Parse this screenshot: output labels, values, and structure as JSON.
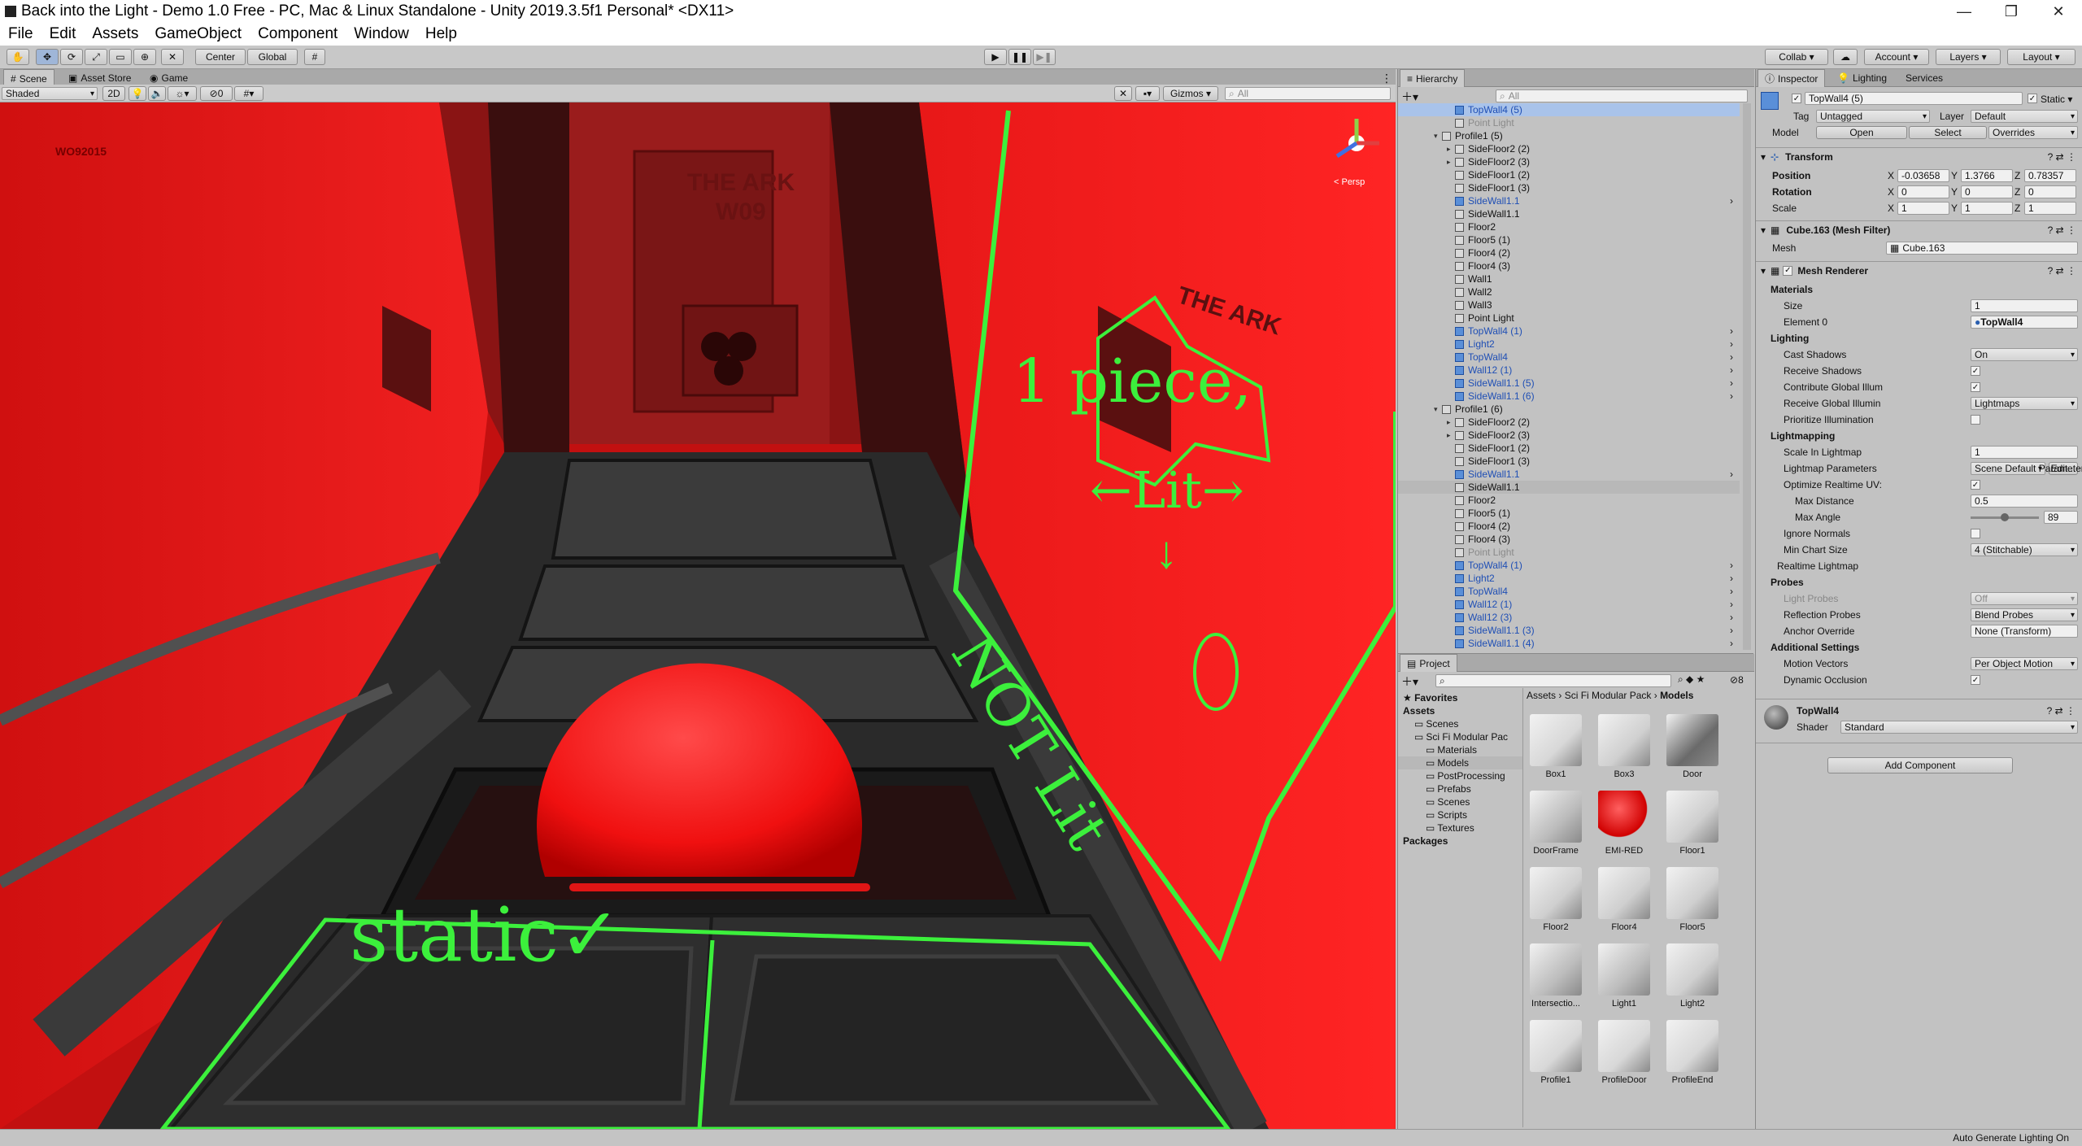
{
  "window": {
    "title": "Back into the Light - Demo 1.0 Free - PC, Mac & Linux Standalone - Unity 2019.3.5f1 Personal* <DX11>",
    "min": "—",
    "max": "❐",
    "close": "✕"
  },
  "menu": [
    "File",
    "Edit",
    "Assets",
    "GameObject",
    "Component",
    "Window",
    "Help"
  ],
  "toolbar": {
    "center": "Center",
    "global": "Global",
    "collab": "Collab ▾",
    "account": "Account ▾",
    "layers": "Layers ▾",
    "layout": "Layout ▾"
  },
  "scene_panel": {
    "tabs": [
      "Scene",
      "Asset Store",
      "Game"
    ],
    "shaded": "Shaded",
    "mode_2d": "2D",
    "gizmos": "Gizmos ▾",
    "search_placeholder": "All",
    "persp": "< Persp",
    "counter": "0"
  },
  "scene_text": {
    "label_left": "WO92015",
    "ark_title": "THE ARK",
    "ark_sub": "W09",
    "wall_logo": "THE ARK"
  },
  "annotations": {
    "static": "static✓",
    "piece": "1 piece,",
    "lit": "←Lit→",
    "not_lit": "NOT Lit",
    "arrow": "↓"
  },
  "hierarchy": {
    "title": "Hierarchy",
    "search_placeholder": "All",
    "items": [
      {
        "name": "TopWall4 (5)",
        "blue": true,
        "indent": 0,
        "sel": true
      },
      {
        "name": "Point Light",
        "grey": true,
        "indent": 0
      },
      {
        "name": "Profile1 (5)",
        "indent": -1,
        "open": true
      },
      {
        "name": "SideFloor2 (2)",
        "indent": 0,
        "arrow": true
      },
      {
        "name": "SideFloor2 (3)",
        "indent": 0,
        "arrow": true
      },
      {
        "name": "SideFloor1 (2)",
        "indent": 0
      },
      {
        "name": "SideFloor1 (3)",
        "indent": 0
      },
      {
        "name": "SideWall1.1",
        "blue": true,
        "indent": 0,
        "more": true
      },
      {
        "name": "SideWall1.1",
        "indent": 0
      },
      {
        "name": "Floor2",
        "indent": 0
      },
      {
        "name": "Floor5 (1)",
        "indent": 0
      },
      {
        "name": "Floor4 (2)",
        "indent": 0
      },
      {
        "name": "Floor4 (3)",
        "indent": 0
      },
      {
        "name": "Wall1",
        "indent": 0
      },
      {
        "name": "Wall2",
        "indent": 0
      },
      {
        "name": "Wall3",
        "indent": 0
      },
      {
        "name": "Point Light",
        "indent": 0
      },
      {
        "name": "TopWall4 (1)",
        "blue": true,
        "indent": 0,
        "more": true
      },
      {
        "name": "Light2",
        "blue": true,
        "indent": 0,
        "more": true
      },
      {
        "name": "TopWall4",
        "blue": true,
        "indent": 0,
        "more": true
      },
      {
        "name": "Wall12 (1)",
        "blue": true,
        "indent": 0,
        "more": true
      },
      {
        "name": "SideWall1.1 (5)",
        "blue": true,
        "indent": 0,
        "more": true
      },
      {
        "name": "SideWall1.1 (6)",
        "blue": true,
        "indent": 0,
        "more": true
      },
      {
        "name": "Profile1 (6)",
        "indent": -1,
        "open": true
      },
      {
        "name": "SideFloor2 (2)",
        "indent": 0,
        "arrow": true
      },
      {
        "name": "SideFloor2 (3)",
        "indent": 0,
        "arrow": true
      },
      {
        "name": "SideFloor1 (2)",
        "indent": 0
      },
      {
        "name": "SideFloor1 (3)",
        "indent": 0
      },
      {
        "name": "SideWall1.1",
        "blue": true,
        "indent": 0,
        "more": true
      },
      {
        "name": "SideWall1.1",
        "indent": 0,
        "hl": true
      },
      {
        "name": "Floor2",
        "indent": 0
      },
      {
        "name": "Floor5 (1)",
        "indent": 0
      },
      {
        "name": "Floor4 (2)",
        "indent": 0
      },
      {
        "name": "Floor4 (3)",
        "indent": 0
      },
      {
        "name": "Point Light",
        "grey": true,
        "indent": 0
      },
      {
        "name": "TopWall4 (1)",
        "blue": true,
        "indent": 0,
        "more": true
      },
      {
        "name": "Light2",
        "blue": true,
        "indent": 0,
        "more": true
      },
      {
        "name": "TopWall4",
        "blue": true,
        "indent": 0,
        "more": true
      },
      {
        "name": "Wall12 (1)",
        "blue": true,
        "indent": 0,
        "more": true
      },
      {
        "name": "Wall12 (3)",
        "blue": true,
        "indent": 0,
        "more": true
      },
      {
        "name": "SideWall1.1 (3)",
        "blue": true,
        "indent": 0,
        "more": true
      },
      {
        "name": "SideWall1.1 (4)",
        "blue": true,
        "indent": 0,
        "more": true
      }
    ]
  },
  "project": {
    "title": "Project",
    "count": "8",
    "tree": [
      {
        "name": "★ Favorites",
        "bold": true,
        "indent": 0
      },
      {
        "name": "Assets",
        "bold": true,
        "indent": 0
      },
      {
        "name": "Scenes",
        "indent": 1
      },
      {
        "name": "Sci Fi Modular Pac",
        "indent": 1
      },
      {
        "name": "Materials",
        "indent": 2
      },
      {
        "name": "Models",
        "indent": 2,
        "sel": true
      },
      {
        "name": "PostProcessing",
        "indent": 2
      },
      {
        "name": "Prefabs",
        "indent": 2
      },
      {
        "name": "Scenes",
        "indent": 2
      },
      {
        "name": "Scripts",
        "indent": 2
      },
      {
        "name": "Textures",
        "indent": 2
      },
      {
        "name": "Packages",
        "bold": true,
        "indent": 0
      }
    ],
    "breadcrumb": [
      "Assets",
      "Sci Fi Modular Pack",
      "Models"
    ],
    "assets": [
      "Box1",
      "Box3",
      "Door",
      "DoorFrame",
      "EMI-RED",
      "Floor1",
      "Floor2",
      "Floor4",
      "Floor5",
      "Intersectio...",
      "Light1",
      "Light2",
      "Profile1",
      "ProfileDoor",
      "ProfileEnd"
    ]
  },
  "inspector": {
    "tabs": [
      "Inspector",
      "Lighting",
      "Services"
    ],
    "name": "TopWall4 (5)",
    "static": "Static ▾",
    "tag_label": "Tag",
    "tag": "Untagged",
    "layer_label": "Layer",
    "layer": "Default",
    "model_label": "Model",
    "open": "Open",
    "select": "Select",
    "overrides": "Overrides",
    "transform": {
      "title": "Transform",
      "position": "Position",
      "rotation": "Rotation",
      "scale": "Scale",
      "px": "-0.03658",
      "py": "1.3766",
      "pz": "0.78357",
      "rx": "0",
      "ry": "0",
      "rz": "0",
      "sx": "1",
      "sy": "1",
      "sz": "1",
      "xl": "X",
      "yl": "Y",
      "zl": "Z"
    },
    "meshfilter": {
      "title": "Cube.163 (Mesh Filter)",
      "mesh_label": "Mesh",
      "mesh": "Cube.163"
    },
    "renderer": {
      "title": "Mesh Renderer",
      "materials": "Materials",
      "size_label": "Size",
      "size": "1",
      "element0_label": "Element 0",
      "element0": "TopWall4",
      "lighting": "Lighting",
      "cast_label": "Cast Shadows",
      "cast": "On",
      "recv_label": "Receive Shadows",
      "contrib_label": "Contribute Global Illum",
      "recvgi_label": "Receive Global Illumin",
      "recvgi": "Lightmaps",
      "prio_label": "Prioritize Illumination",
      "lightmapping": "Lightmapping",
      "scale_lm_label": "Scale In Lightmap",
      "scale_lm": "1",
      "lmparams_label": "Lightmap Parameters",
      "lmparams": "Scene Default Parameters",
      "edit": "Edit...",
      "optimize_label": "Optimize Realtime UV:",
      "maxdist_label": "Max Distance",
      "maxdist": "0.5",
      "maxangle_label": "Max Angle",
      "maxangle": "89",
      "ignore_label": "Ignore Normals",
      "minchart_label": "Min Chart Size",
      "minchart": "4 (Stitchable)",
      "realtime_lm": "Realtime Lightmap",
      "probes": "Probes",
      "lightprobes_label": "Light Probes",
      "lightprobes": "Off",
      "reflprobes_label": "Reflection Probes",
      "reflprobes": "Blend Probes",
      "anchor_label": "Anchor Override",
      "anchor": "None (Transform)",
      "additional": "Additional Settings",
      "motion_label": "Motion Vectors",
      "motion": "Per Object Motion",
      "dynocc_label": "Dynamic Occlusion"
    },
    "material": {
      "name": "TopWall4",
      "shader_label": "Shader",
      "shader": "Standard"
    },
    "add_component": "Add Component"
  },
  "status": "Auto Generate Lighting On",
  "colors": {
    "annotation": "#3cf03c",
    "scene_red": "#e01818",
    "blue_text": "#1f4fb5"
  }
}
